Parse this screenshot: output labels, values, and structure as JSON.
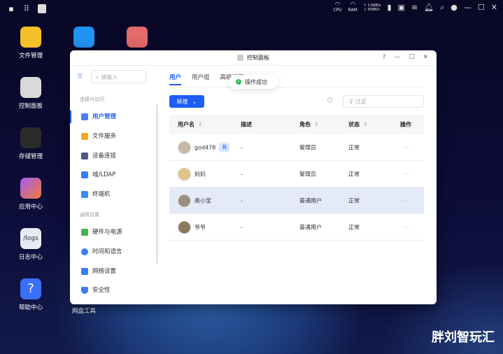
{
  "topbar": {
    "net_up": "↑ 1.6KB/s",
    "net_down": "↓ 958B/s",
    "cpu": "CPU",
    "ram": "RAM"
  },
  "desktop": [
    {
      "label": "文件管理",
      "color": "#f4c02a"
    },
    {
      "label": "控制面板",
      "color": "#d9d9d9"
    },
    {
      "label": "存储管理",
      "color": "#2a2a2a"
    },
    {
      "label": "应用中心",
      "color": "#f5f5f5"
    },
    {
      "label": "日志中心",
      "color": "#e6ebf3",
      "text": "/logs"
    },
    {
      "label": "帮助中心",
      "color": "#3a6ff7",
      "text": "?"
    },
    {
      "label": "网盘工具",
      "color": "#2094f3"
    },
    {
      "label": "",
      "color": "#e56a6a"
    }
  ],
  "window": {
    "title": "控制面板",
    "help": "?"
  },
  "sidebar": {
    "search_placeholder": "请输入",
    "sections": [
      {
        "title": "连接与访问",
        "items": [
          {
            "label": "用户管理",
            "color": "#4a7cf7"
          },
          {
            "label": "文件服务",
            "color": "#f5a623"
          },
          {
            "label": "设备连接",
            "color": "#4a5a80"
          },
          {
            "label": "域/LDAP",
            "color": "#3a7cf7"
          },
          {
            "label": "终端机",
            "color": "#3a8cf7"
          }
        ]
      },
      {
        "title": "通用设置",
        "items": [
          {
            "label": "硬件与电源",
            "color": "#4caf50"
          },
          {
            "label": "时间和语言",
            "color": "#3a7cf7"
          },
          {
            "label": "网络设置",
            "color": "#3a7cf7"
          },
          {
            "label": "安全性",
            "color": "#3a7cf7"
          }
        ]
      }
    ]
  },
  "tabs": [
    "用户",
    "用户组",
    "高级设置"
  ],
  "toast": "操作成功",
  "add_button": "新增",
  "filter_placeholder": "过滤",
  "table": {
    "headers": [
      "用户名",
      "描述",
      "角色",
      "状态",
      "操作"
    ],
    "rows": [
      {
        "name": "god478",
        "badge": "我",
        "desc": "-",
        "role": "管理员",
        "status": "正常",
        "action": "···"
      },
      {
        "name": "妈妈",
        "desc": "-",
        "role": "管理员",
        "status": "正常",
        "action": "···"
      },
      {
        "name": "奥小宝",
        "desc": "-",
        "role": "普通用户",
        "status": "正常",
        "action": "···"
      },
      {
        "name": "爷爷",
        "desc": "-",
        "role": "普通用户",
        "status": "正常",
        "action": "···"
      }
    ]
  },
  "watermark": "胖刘智玩汇"
}
